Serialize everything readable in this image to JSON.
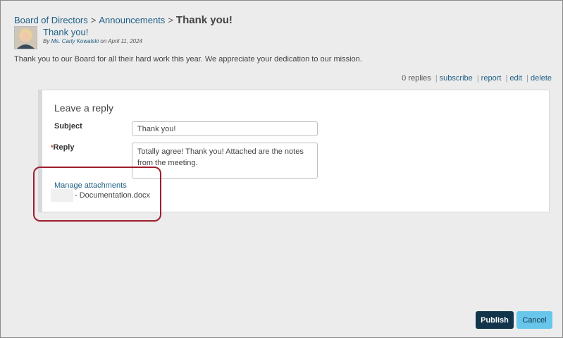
{
  "breadcrumb": {
    "group": "Board of Directors",
    "section": "Announcements",
    "separator": ">",
    "current": "Thank you!"
  },
  "post": {
    "title": "Thank you!",
    "by_prefix": "By",
    "author": "Ms. Carly Kowalski",
    "date_text": "on April 11, 2024",
    "body": "Thank you to our Board for all their hard work this year. We appreciate your dedication to our mission."
  },
  "actions": {
    "replies": "0 replies",
    "subscribe": "subscribe",
    "report": "report",
    "edit": "edit",
    "delete": "delete",
    "separator": "|"
  },
  "reply_form": {
    "heading": "Leave a reply",
    "subject_label": "Subject",
    "subject_value": "Thank you!",
    "reply_required_marker": "*",
    "reply_label": "Reply",
    "reply_value": "Totally agree! Thank you! Attached are the notes from the meeting.",
    "manage_attachments": "Manage attachments",
    "attachment_name": "- Documentation.docx"
  },
  "buttons": {
    "publish": "Publish",
    "cancel": "Cancel"
  },
  "colors": {
    "link": "#1f5f86",
    "publish_bg": "#12354b",
    "cancel_bg": "#67c6ea",
    "highlight": "#9c1f2e"
  }
}
